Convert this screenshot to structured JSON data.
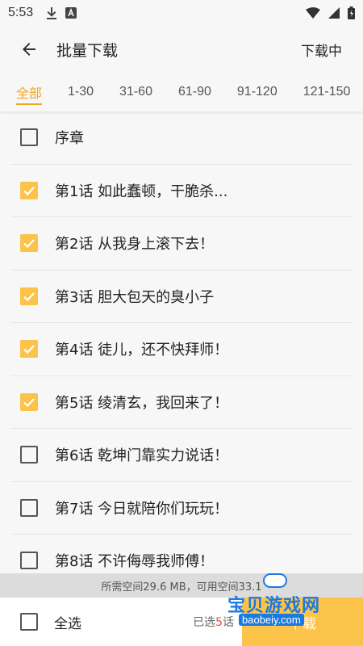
{
  "status_bar": {
    "time": "5:53",
    "left_icons": [
      "download-icon",
      "a-box-icon"
    ],
    "right_icons": [
      "wifi-icon",
      "signal-icon",
      "battery-icon"
    ]
  },
  "app_bar": {
    "title": "批量下载",
    "action_label": "下载中"
  },
  "tabs": [
    {
      "label": "全部",
      "active": true
    },
    {
      "label": "1-30",
      "active": false
    },
    {
      "label": "31-60",
      "active": false
    },
    {
      "label": "61-90",
      "active": false
    },
    {
      "label": "91-120",
      "active": false
    },
    {
      "label": "121-150",
      "active": false
    }
  ],
  "chapters": [
    {
      "label": "序章",
      "checked": false
    },
    {
      "label": "第1话 如此蠢顿，干脆杀...",
      "checked": true
    },
    {
      "label": "第2话 从我身上滚下去！",
      "checked": true
    },
    {
      "label": "第3话 胆大包天的臭小子",
      "checked": true
    },
    {
      "label": "第4话 徒儿，还不快拜师！",
      "checked": true
    },
    {
      "label": "第5话 绫清玄，我回来了！",
      "checked": true
    },
    {
      "label": "第6话 乾坤门靠实力说话！",
      "checked": false
    },
    {
      "label": "第7话 今日就陪你们玩玩！",
      "checked": false
    },
    {
      "label": "第8话 不许侮辱我师傅！",
      "checked": false
    }
  ],
  "storage_info": "所需空间29.6 MB，可用空间33.1",
  "bottom_bar": {
    "select_all_label": "全选",
    "select_all_checked": false,
    "selected_prefix": "已选",
    "selected_count": "5",
    "selected_suffix": "话",
    "download_label": "下载"
  },
  "watermark": {
    "text": "宝贝游戏网",
    "url": "baobeiy.com"
  },
  "colors": {
    "accent": "#f5a623",
    "checkbox_fill": "#fcc34a",
    "count_red": "#e94b3c"
  }
}
